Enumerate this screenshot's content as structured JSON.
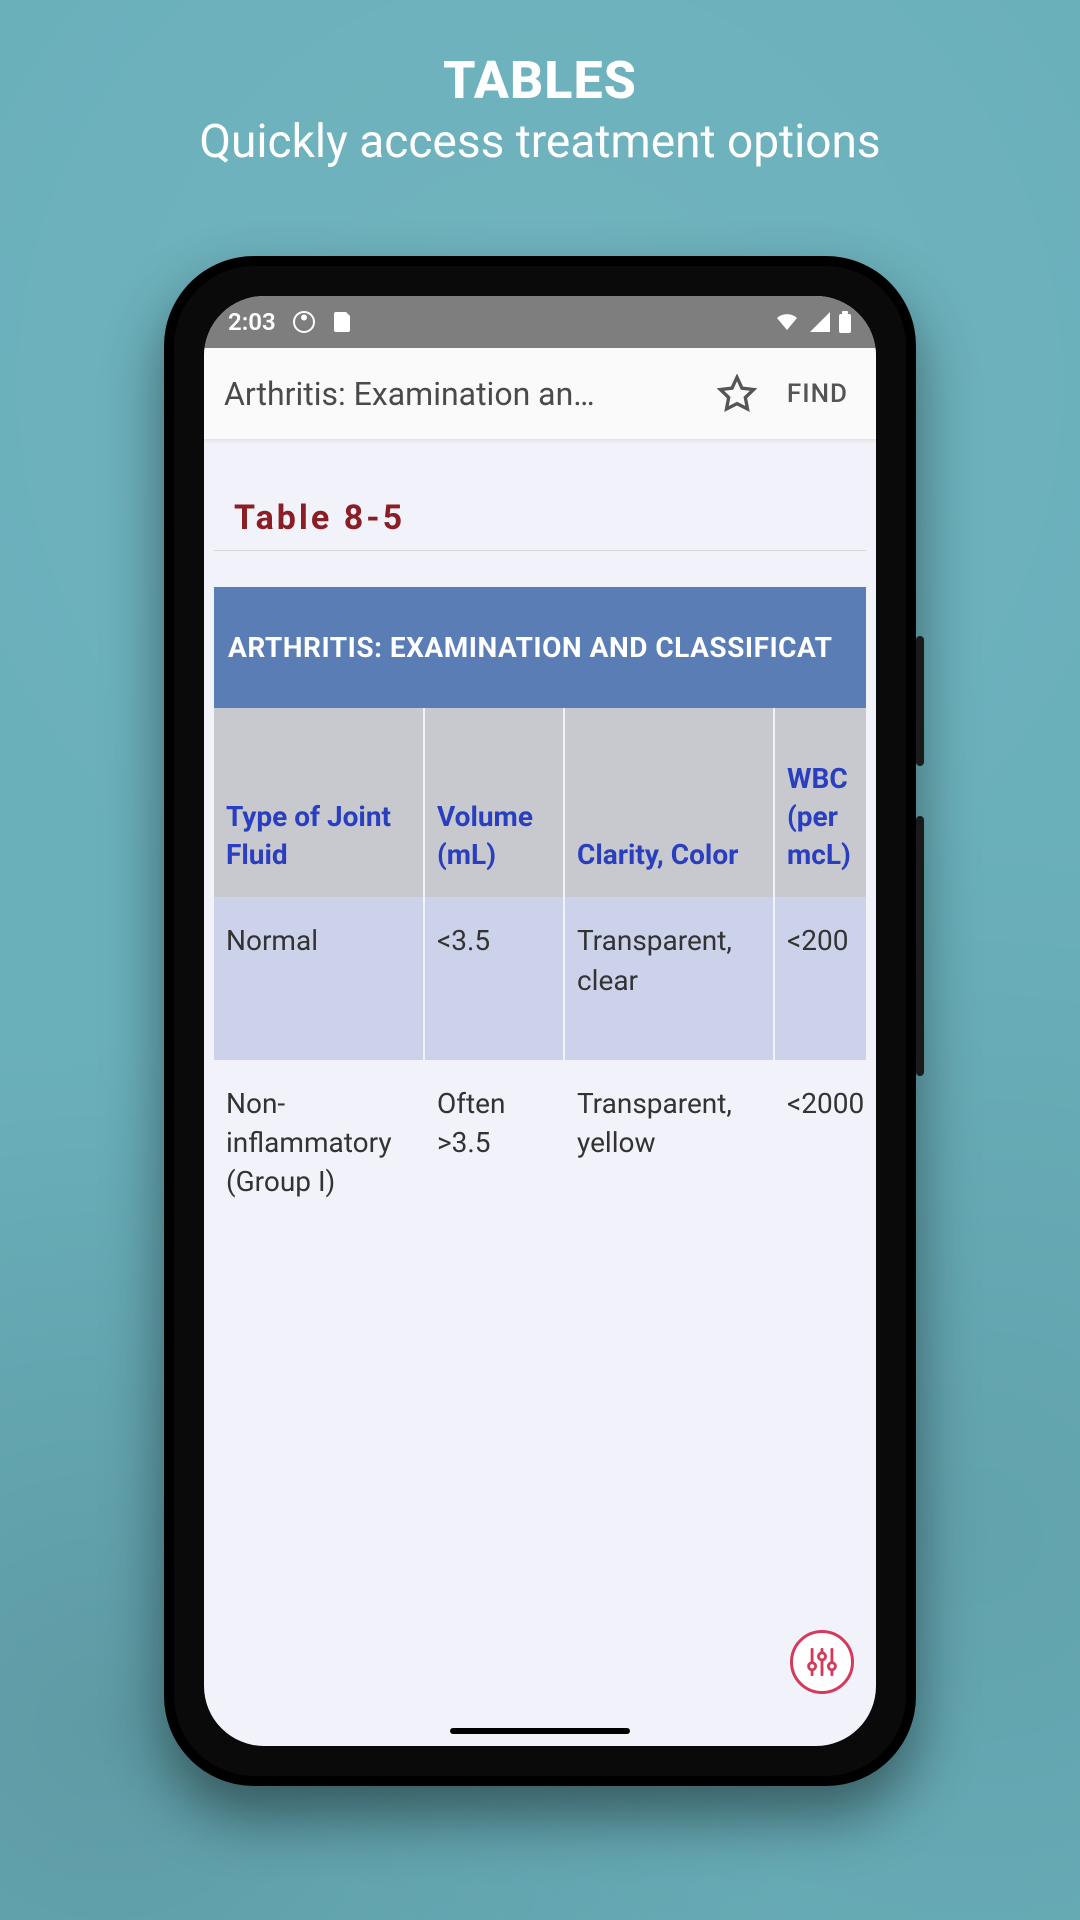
{
  "promo": {
    "title": "TABLES",
    "subtitle": "Quickly access treatment options"
  },
  "status": {
    "time": "2:03"
  },
  "appbar": {
    "title": "Arthritis: Examination an…",
    "find_label": "FIND"
  },
  "content": {
    "table_label": "Table 8-5",
    "table_caption": "ARTHRITIS: EXAMINATION AND CLASSIFICAT",
    "columns": [
      "Type of Joint Fluid",
      "Volume (mL)",
      "Clarity, Color",
      "WBC (per mcL)"
    ],
    "rows": [
      {
        "type": "Normal",
        "volume": "<3.5",
        "clarity": "Transparent, clear",
        "wbc": "<200"
      },
      {
        "type": "Non-inflammatory (Group I)",
        "volume": "Often >3.5",
        "clarity": "Transparent, yellow",
        "wbc": "<2000"
      }
    ]
  }
}
